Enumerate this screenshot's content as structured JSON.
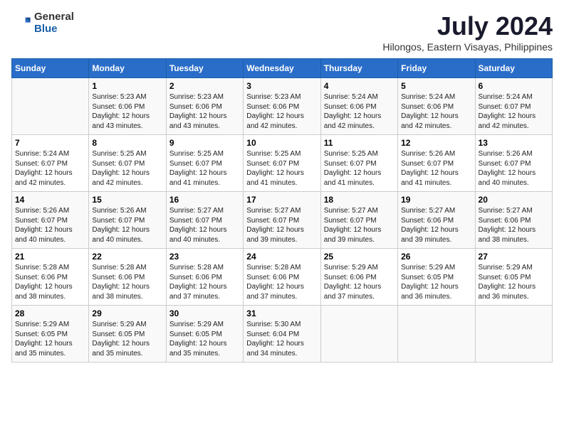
{
  "logo": {
    "general": "General",
    "blue": "Blue"
  },
  "title": "July 2024",
  "subtitle": "Hilongos, Eastern Visayas, Philippines",
  "header_days": [
    "Sunday",
    "Monday",
    "Tuesday",
    "Wednesday",
    "Thursday",
    "Friday",
    "Saturday"
  ],
  "weeks": [
    [
      {
        "num": "",
        "info": ""
      },
      {
        "num": "1",
        "info": "Sunrise: 5:23 AM\nSunset: 6:06 PM\nDaylight: 12 hours\nand 43 minutes."
      },
      {
        "num": "2",
        "info": "Sunrise: 5:23 AM\nSunset: 6:06 PM\nDaylight: 12 hours\nand 43 minutes."
      },
      {
        "num": "3",
        "info": "Sunrise: 5:23 AM\nSunset: 6:06 PM\nDaylight: 12 hours\nand 42 minutes."
      },
      {
        "num": "4",
        "info": "Sunrise: 5:24 AM\nSunset: 6:06 PM\nDaylight: 12 hours\nand 42 minutes."
      },
      {
        "num": "5",
        "info": "Sunrise: 5:24 AM\nSunset: 6:06 PM\nDaylight: 12 hours\nand 42 minutes."
      },
      {
        "num": "6",
        "info": "Sunrise: 5:24 AM\nSunset: 6:07 PM\nDaylight: 12 hours\nand 42 minutes."
      }
    ],
    [
      {
        "num": "7",
        "info": "Sunrise: 5:24 AM\nSunset: 6:07 PM\nDaylight: 12 hours\nand 42 minutes."
      },
      {
        "num": "8",
        "info": "Sunrise: 5:25 AM\nSunset: 6:07 PM\nDaylight: 12 hours\nand 42 minutes."
      },
      {
        "num": "9",
        "info": "Sunrise: 5:25 AM\nSunset: 6:07 PM\nDaylight: 12 hours\nand 41 minutes."
      },
      {
        "num": "10",
        "info": "Sunrise: 5:25 AM\nSunset: 6:07 PM\nDaylight: 12 hours\nand 41 minutes."
      },
      {
        "num": "11",
        "info": "Sunrise: 5:25 AM\nSunset: 6:07 PM\nDaylight: 12 hours\nand 41 minutes."
      },
      {
        "num": "12",
        "info": "Sunrise: 5:26 AM\nSunset: 6:07 PM\nDaylight: 12 hours\nand 41 minutes."
      },
      {
        "num": "13",
        "info": "Sunrise: 5:26 AM\nSunset: 6:07 PM\nDaylight: 12 hours\nand 40 minutes."
      }
    ],
    [
      {
        "num": "14",
        "info": "Sunrise: 5:26 AM\nSunset: 6:07 PM\nDaylight: 12 hours\nand 40 minutes."
      },
      {
        "num": "15",
        "info": "Sunrise: 5:26 AM\nSunset: 6:07 PM\nDaylight: 12 hours\nand 40 minutes."
      },
      {
        "num": "16",
        "info": "Sunrise: 5:27 AM\nSunset: 6:07 PM\nDaylight: 12 hours\nand 40 minutes."
      },
      {
        "num": "17",
        "info": "Sunrise: 5:27 AM\nSunset: 6:07 PM\nDaylight: 12 hours\nand 39 minutes."
      },
      {
        "num": "18",
        "info": "Sunrise: 5:27 AM\nSunset: 6:07 PM\nDaylight: 12 hours\nand 39 minutes."
      },
      {
        "num": "19",
        "info": "Sunrise: 5:27 AM\nSunset: 6:06 PM\nDaylight: 12 hours\nand 39 minutes."
      },
      {
        "num": "20",
        "info": "Sunrise: 5:27 AM\nSunset: 6:06 PM\nDaylight: 12 hours\nand 38 minutes."
      }
    ],
    [
      {
        "num": "21",
        "info": "Sunrise: 5:28 AM\nSunset: 6:06 PM\nDaylight: 12 hours\nand 38 minutes."
      },
      {
        "num": "22",
        "info": "Sunrise: 5:28 AM\nSunset: 6:06 PM\nDaylight: 12 hours\nand 38 minutes."
      },
      {
        "num": "23",
        "info": "Sunrise: 5:28 AM\nSunset: 6:06 PM\nDaylight: 12 hours\nand 37 minutes."
      },
      {
        "num": "24",
        "info": "Sunrise: 5:28 AM\nSunset: 6:06 PM\nDaylight: 12 hours\nand 37 minutes."
      },
      {
        "num": "25",
        "info": "Sunrise: 5:29 AM\nSunset: 6:06 PM\nDaylight: 12 hours\nand 37 minutes."
      },
      {
        "num": "26",
        "info": "Sunrise: 5:29 AM\nSunset: 6:05 PM\nDaylight: 12 hours\nand 36 minutes."
      },
      {
        "num": "27",
        "info": "Sunrise: 5:29 AM\nSunset: 6:05 PM\nDaylight: 12 hours\nand 36 minutes."
      }
    ],
    [
      {
        "num": "28",
        "info": "Sunrise: 5:29 AM\nSunset: 6:05 PM\nDaylight: 12 hours\nand 35 minutes."
      },
      {
        "num": "29",
        "info": "Sunrise: 5:29 AM\nSunset: 6:05 PM\nDaylight: 12 hours\nand 35 minutes."
      },
      {
        "num": "30",
        "info": "Sunrise: 5:29 AM\nSunset: 6:05 PM\nDaylight: 12 hours\nand 35 minutes."
      },
      {
        "num": "31",
        "info": "Sunrise: 5:30 AM\nSunset: 6:04 PM\nDaylight: 12 hours\nand 34 minutes."
      },
      {
        "num": "",
        "info": ""
      },
      {
        "num": "",
        "info": ""
      },
      {
        "num": "",
        "info": ""
      }
    ]
  ]
}
